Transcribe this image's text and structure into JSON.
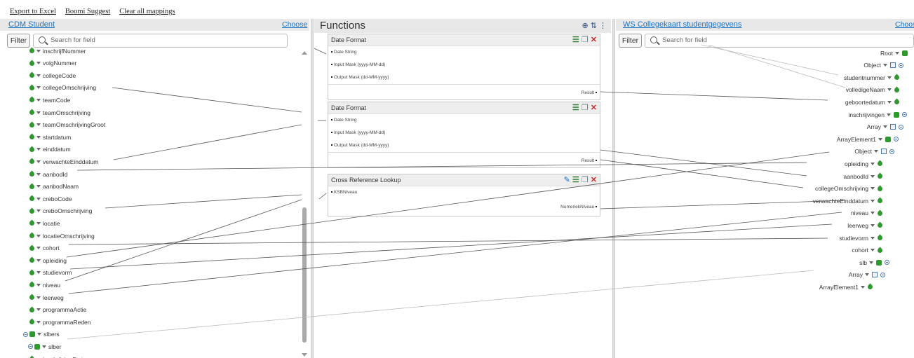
{
  "toolbar": {
    "export_label": "Export to Excel",
    "suggest_label": "Boomi Suggest",
    "clear_label": "Clear all mappings"
  },
  "source": {
    "title": "CDM Student",
    "choose": "Choose",
    "filter": "Filter",
    "search_placeholder": "Search for field",
    "items": [
      "inschrijfNummer",
      "volgNummer",
      "collegeCode",
      "collegeOmschrijving",
      "teamCode",
      "teamOmschrijving",
      "teamOmschrijvingGroot",
      "startdatum",
      "einddatum",
      "verwachteEinddatum",
      "aanbodId",
      "aanbodNaam",
      "creboCode",
      "creboOmschrijving",
      "locatie",
      "locatieOmschrijving",
      "cohort",
      "opleiding",
      "studievorm",
      "niveau",
      "leerweg",
      "programmaActie",
      "programmaReden",
      "slbers",
      "slber",
      "inschrijvingStatus"
    ]
  },
  "functions": {
    "title": "Functions",
    "boxes": [
      {
        "title": "Date Format",
        "inputs": [
          "Date String",
          "Input Mask (yyyy-MM-dd)",
          "Output Mask (dd-MM-yyyy)"
        ],
        "output": "Result"
      },
      {
        "title": "Date Format",
        "inputs": [
          "Date String",
          "Input Mask (yyyy-MM-dd)",
          "Output Mask (dd-MM-yyyy)"
        ],
        "output": "Result"
      },
      {
        "title": "Cross Reference Lookup",
        "inputs": [
          "KSBNiveau"
        ],
        "output": "NumeriekNiveau"
      }
    ]
  },
  "target": {
    "title": "WS Collegekaart studentgegevens",
    "choose": "Choos",
    "filter": "Filter",
    "search_placeholder": "Search for field",
    "items": [
      "Root",
      "Object",
      "studentnummer",
      "volledigeNaam",
      "geboortedatum",
      "inschrijvingen",
      "Array",
      "ArrayElement1",
      "Object",
      "opleiding",
      "aanbodId",
      "collegeOmschrijving",
      "verwachteEinddatum",
      "niveau",
      "leerweg",
      "studievorm",
      "cohort",
      "slb",
      "Array",
      "ArrayElement1"
    ]
  },
  "colors": {
    "link": "#1a73c4",
    "leaf": "#2e9a2e",
    "delete": "#d9252b"
  }
}
